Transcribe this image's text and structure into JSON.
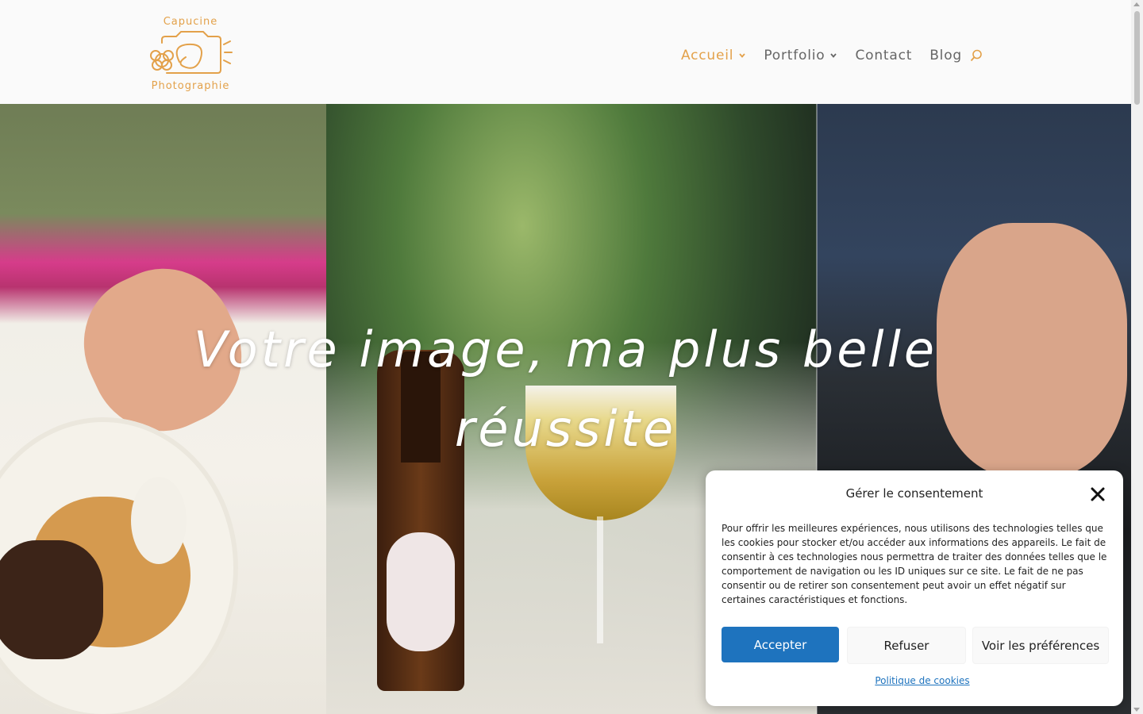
{
  "header": {
    "logo": {
      "line1": "Capucine",
      "line2": "Photographie"
    },
    "nav": [
      {
        "label": "Accueil",
        "active": true,
        "has_dropdown": true
      },
      {
        "label": "Portfolio",
        "active": false,
        "has_dropdown": true
      },
      {
        "label": "Contact",
        "active": false,
        "has_dropdown": false
      },
      {
        "label": "Blog",
        "active": false,
        "has_dropdown": false
      }
    ],
    "search_icon": "search-icon"
  },
  "hero": {
    "title_line1": "Votre image, ma plus belle",
    "title_line2": "réussite"
  },
  "cookie_banner": {
    "title": "Gérer le consentement",
    "close_icon": "close-icon",
    "text": "Pour offrir les meilleures expériences, nous utilisons des technologies telles que les cookies pour stocker et/ou accéder aux informations des appareils. Le fait de consentir à ces technologies nous permettra de traiter des données telles que le comportement de navigation ou les ID uniques sur ce site. Le fait de ne pas consentir ou de retirer son consentement peut avoir un effet négatif sur certaines caractéristiques et fonctions.",
    "accept_label": "Accepter",
    "refuse_label": "Refuser",
    "preferences_label": "Voir les préférences",
    "policy_link": "Politique de cookies"
  },
  "colors": {
    "accent": "#e3a14a",
    "nav_text": "#666666",
    "button_primary": "#1e73be",
    "link": "#1e73be"
  }
}
